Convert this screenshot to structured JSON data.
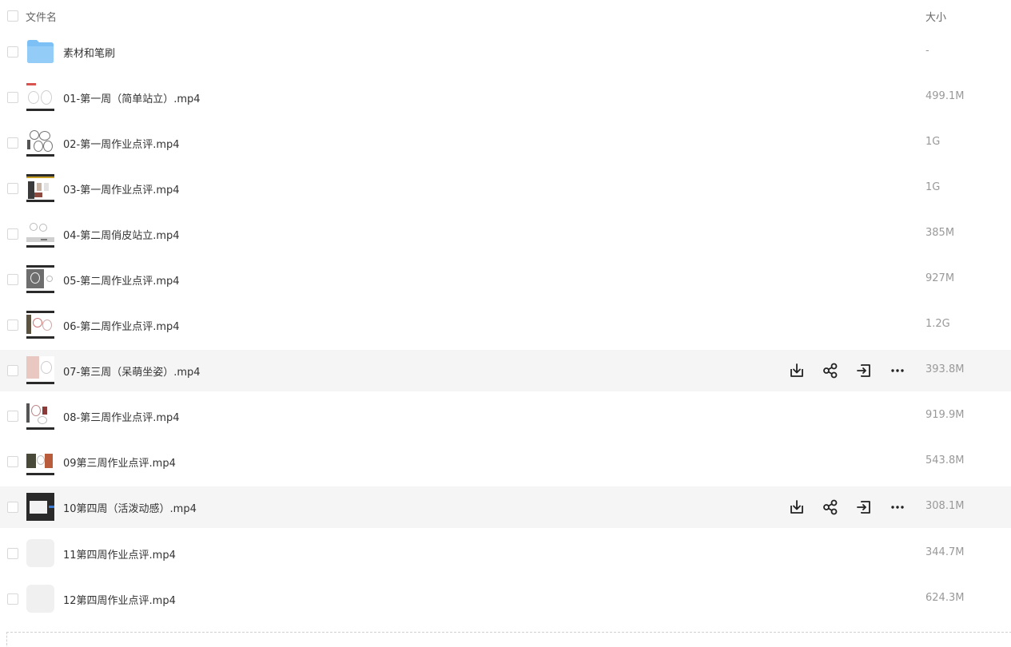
{
  "header": {
    "name_label": "文件名",
    "size_label": "大小"
  },
  "files": [
    {
      "name": "素材和笔刷",
      "size": "-",
      "type": "folder-icon"
    },
    {
      "name": "01-第一周（简单站立）.mp4",
      "size": "499.1M",
      "type": "video-thumbnail"
    },
    {
      "name": "02-第一周作业点评.mp4",
      "size": "1G",
      "type": "video-thumbnail"
    },
    {
      "name": "03-第一周作业点评.mp4",
      "size": "1G",
      "type": "video-thumbnail"
    },
    {
      "name": "04-第二周俏皮站立.mp4",
      "size": "385M",
      "type": "video-thumbnail"
    },
    {
      "name": "05-第二周作业点评.mp4",
      "size": "927M",
      "type": "video-thumbnail"
    },
    {
      "name": "06-第二周作业点评.mp4",
      "size": "1.2G",
      "type": "video-thumbnail"
    },
    {
      "name": "07-第三周（呆萌坐姿）.mp4",
      "size": "393.8M",
      "type": "video-thumbnail",
      "hovered": true
    },
    {
      "name": "08-第三周作业点评.mp4",
      "size": "919.9M",
      "type": "video-thumbnail"
    },
    {
      "name": "09第三周作业点评.mp4",
      "size": "543.8M",
      "type": "video-thumbnail"
    },
    {
      "name": "10第四周（活泼动感）.mp4",
      "size": "308.1M",
      "type": "video-thumbnail",
      "hovered": true
    },
    {
      "name": "11第四周作业点评.mp4",
      "size": "344.7M",
      "type": "placeholder-thumbnail"
    },
    {
      "name": "12第四周作业点评.mp4",
      "size": "624.3M",
      "type": "placeholder-thumbnail"
    }
  ],
  "row_actions": [
    "download-icon",
    "share-icon",
    "move-icon",
    "more-icon"
  ],
  "colors": {
    "hover_row": "#f5f5f6",
    "folder": "#7cc0f5",
    "text_primary": "#333333",
    "text_secondary": "#999999"
  }
}
